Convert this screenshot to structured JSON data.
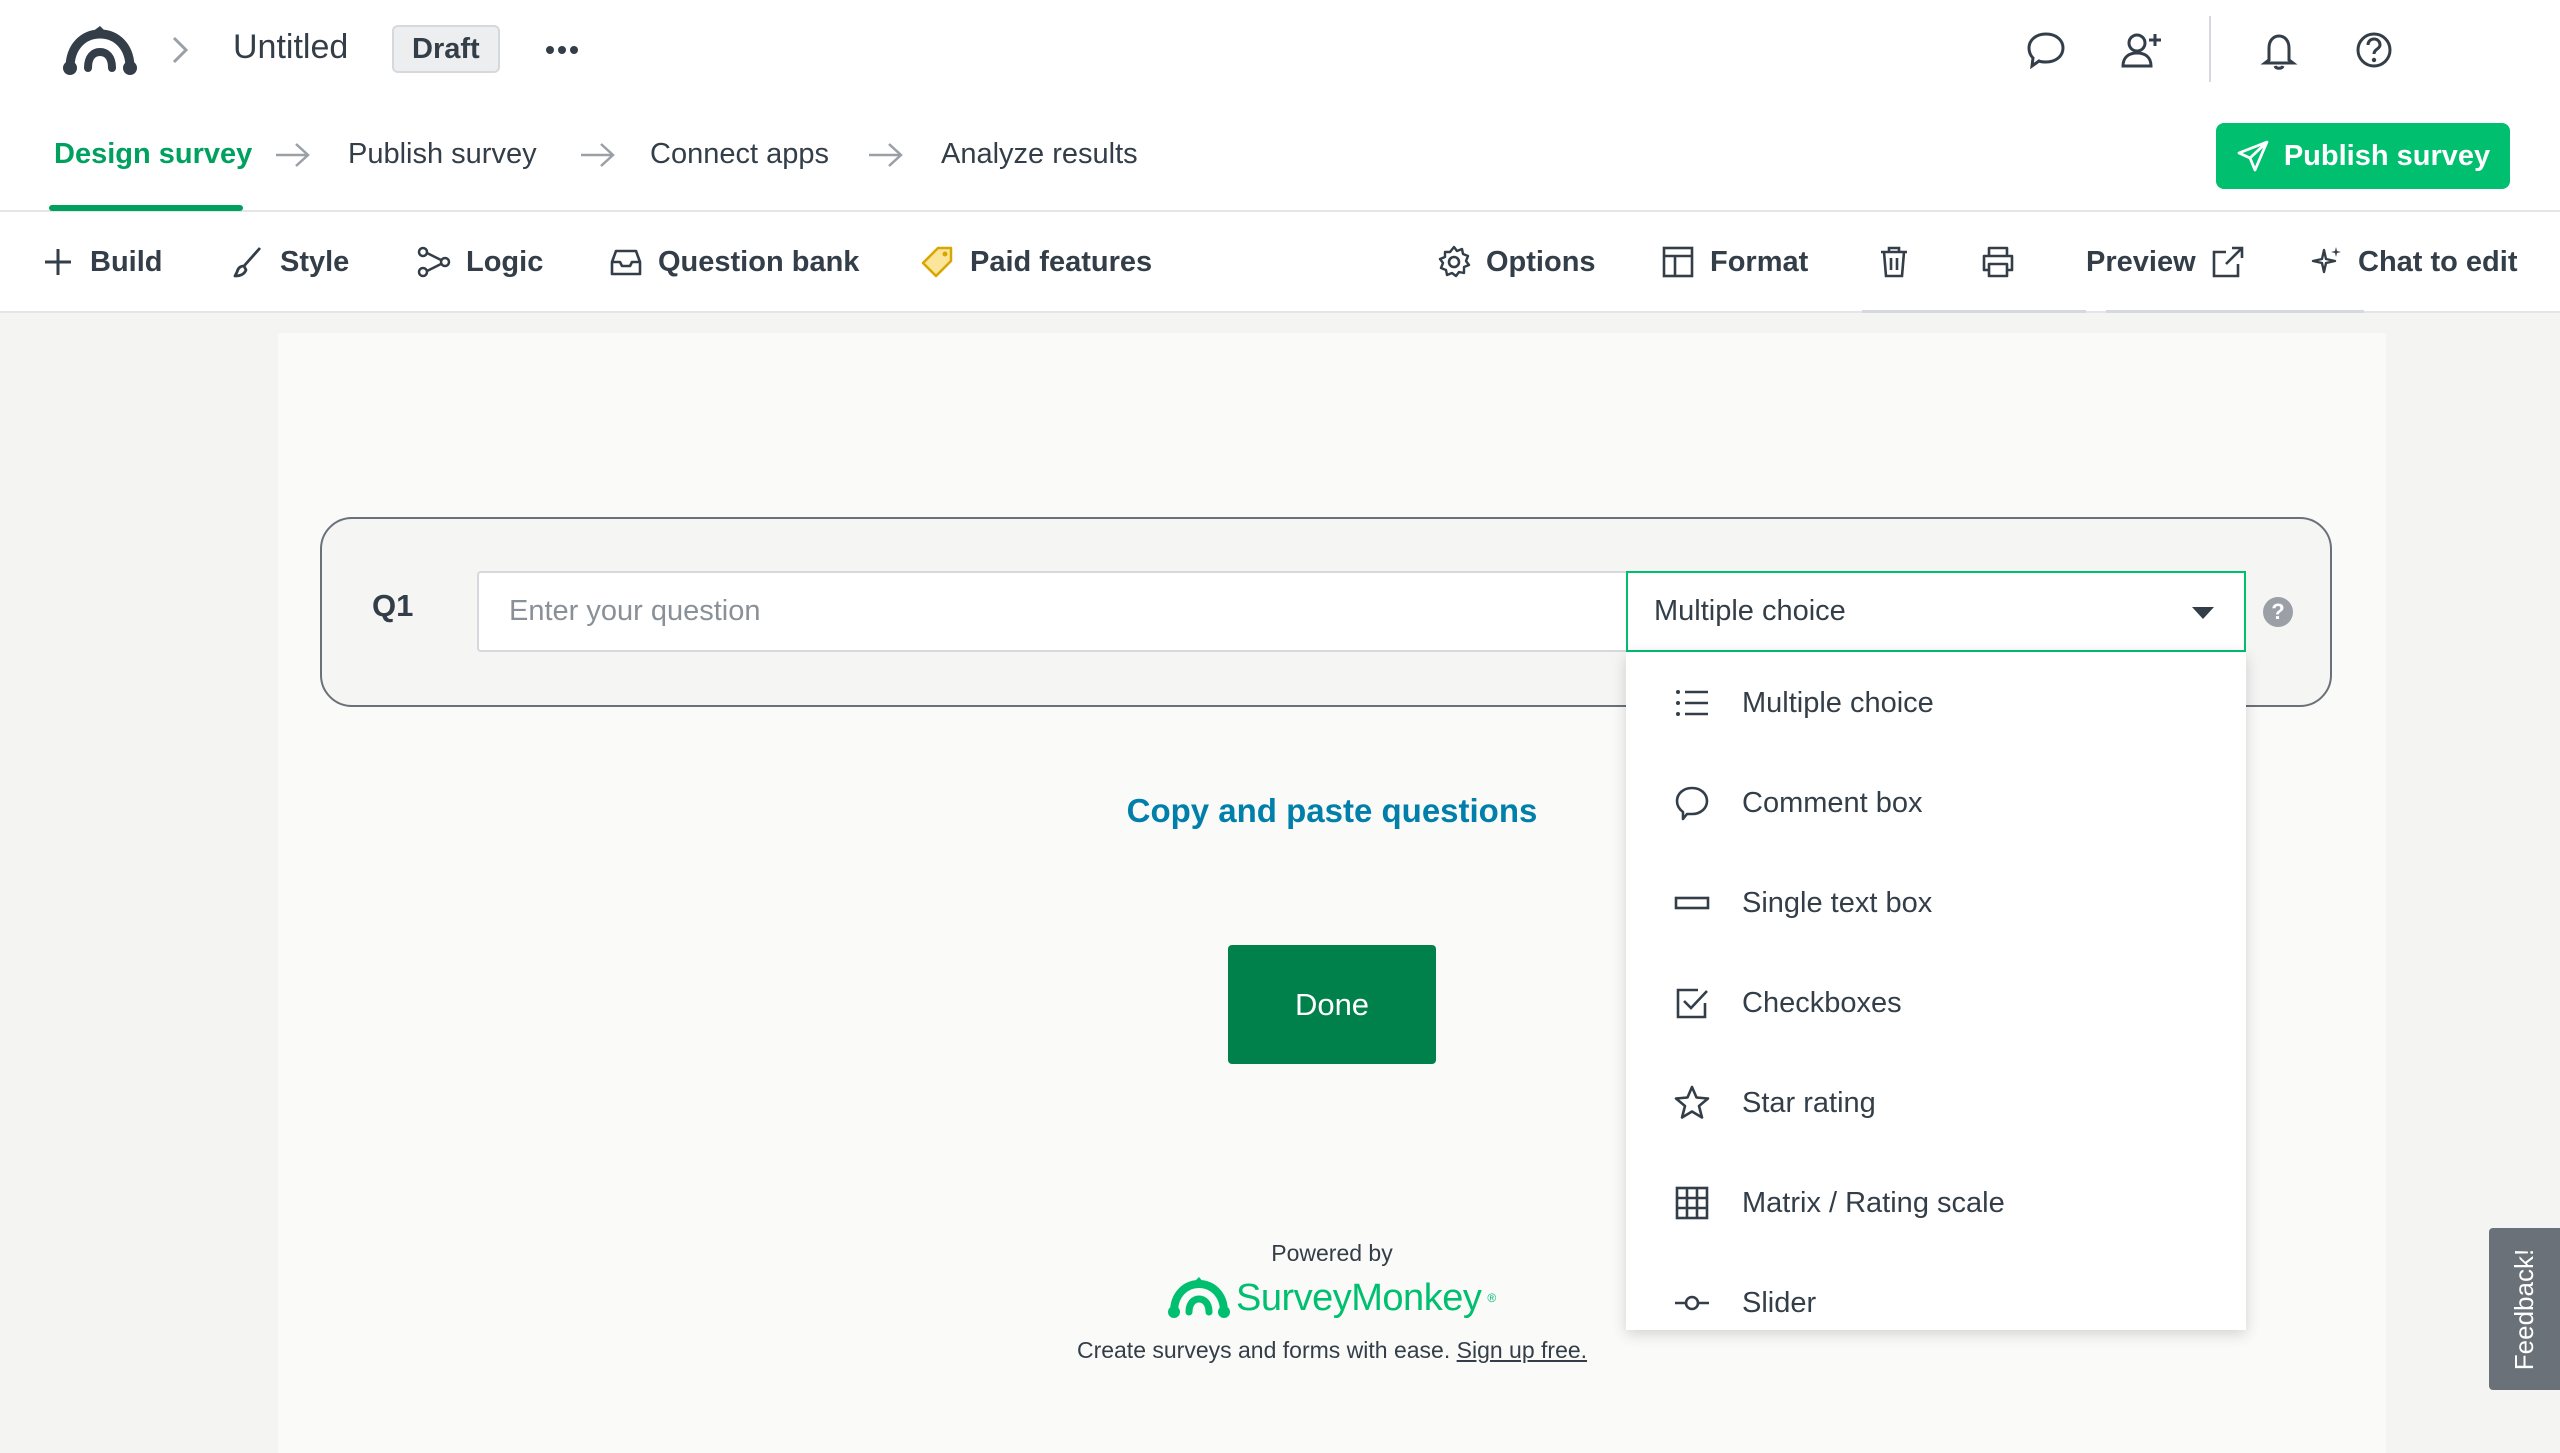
{
  "header": {
    "title": "Untitled",
    "status_badge": "Draft",
    "icons": [
      "monkey-logo-icon",
      "chevron-right-icon",
      "more-icon",
      "chat-bubble-icon",
      "add-user-icon",
      "bell-icon",
      "help-circle-icon"
    ]
  },
  "steps": [
    {
      "label": "Design survey",
      "active": true
    },
    {
      "label": "Publish survey",
      "active": false
    },
    {
      "label": "Connect apps",
      "active": false
    },
    {
      "label": "Analyze results",
      "active": false
    }
  ],
  "publish_button": "Publish survey",
  "toolbar": {
    "build": "Build",
    "style": "Style",
    "logic": "Logic",
    "question_bank": "Question bank",
    "paid_features": "Paid features",
    "options": "Options",
    "format": "Format",
    "preview": "Preview",
    "chat_to_edit": "Chat to edit"
  },
  "question": {
    "number": "Q1",
    "placeholder": "Enter your question",
    "type": "Multiple choice"
  },
  "dropdown": {
    "items": [
      {
        "label": "Multiple choice",
        "icon": "list-icon"
      },
      {
        "label": "Comment box",
        "icon": "comment-icon"
      },
      {
        "label": "Single text box",
        "icon": "textbox-icon"
      },
      {
        "label": "Checkboxes",
        "icon": "checkbox-icon"
      },
      {
        "label": "Star rating",
        "icon": "star-icon"
      },
      {
        "label": "Matrix / Rating scale",
        "icon": "matrix-icon"
      },
      {
        "label": "Slider",
        "icon": "slider-icon"
      }
    ]
  },
  "copy_paste": "Copy and paste questions",
  "done_button": "Done",
  "footer": {
    "powered_by": "Powered by",
    "brand": "SurveyMonkey",
    "trademark": "®",
    "tagline": "Create surveys and forms with ease.",
    "signup": "Sign up free."
  },
  "feedback": "Feedback!",
  "colors": {
    "accent": "#00bf6f",
    "active_step": "#00a05e",
    "done_button": "#00804a",
    "link": "#007faa",
    "text": "#333e48"
  }
}
